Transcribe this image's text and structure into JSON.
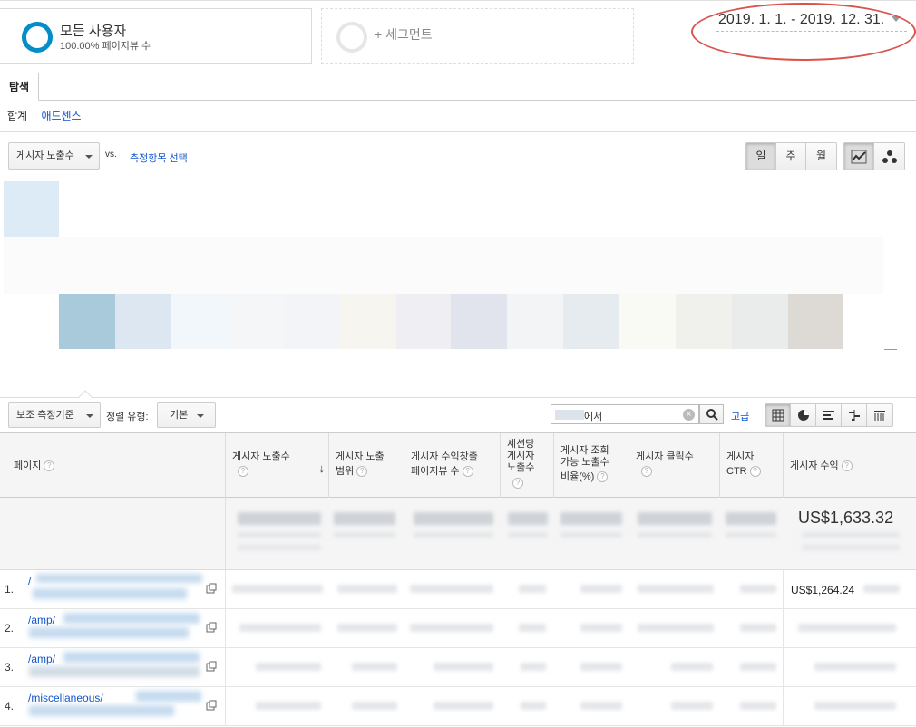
{
  "segments": {
    "primary": {
      "title": "모든 사용자",
      "subtitle": "100.00% 페이지뷰 수"
    },
    "add_label": "+ 세그먼트"
  },
  "date_range": "2019. 1. 1. - 2019. 12. 31.",
  "tabs": {
    "explorer": "탐색"
  },
  "subtabs": {
    "summary": "합계",
    "adsense": "애드센스"
  },
  "metric": {
    "selected": "게시자 노출수",
    "vs": "vs.",
    "select_link": "측정항목 선택"
  },
  "time_buttons": [
    "일",
    "주",
    "월"
  ],
  "table_controls": {
    "secondary_dimension": "보조 측정기준",
    "sort_type_label": "정렬 유형:",
    "sort_type_value": "기본",
    "search_suffix": "에서",
    "advanced": "고급"
  },
  "columns": {
    "page": "페이지",
    "impressions": "게시자 노출수",
    "coverage_1": "게시자 노출",
    "coverage_2": "범위",
    "monetized_1": "게시자 수익창출",
    "monetized_2": "페이지뷰 수",
    "per_session_1": "세션당",
    "per_session_2": "게시자",
    "per_session_3": "노출수",
    "viewable_1": "게시자 조회",
    "viewable_2": "가능 노출수",
    "viewable_3": "비율(%)",
    "clicks": "게시자 클릭수",
    "ctr_1": "게시자",
    "ctr_2": "CTR",
    "revenue": "게시자 수익"
  },
  "help_glyph": "?",
  "sort_glyph": "↓",
  "totals": {
    "revenue": "US$1,633.32"
  },
  "rows": [
    {
      "num": "1.",
      "link": "/",
      "revenue": "US$1,264.24"
    },
    {
      "num": "2.",
      "link": "/amp/",
      "revenue": ""
    },
    {
      "num": "3.",
      "link": "/amp/",
      "revenue": ""
    },
    {
      "num": "4.",
      "link": "/miscellaneous/",
      "revenue": ""
    }
  ],
  "colors": {
    "accent": "#058dc7",
    "link": "#1155cc",
    "annotation": "#d9534f"
  }
}
